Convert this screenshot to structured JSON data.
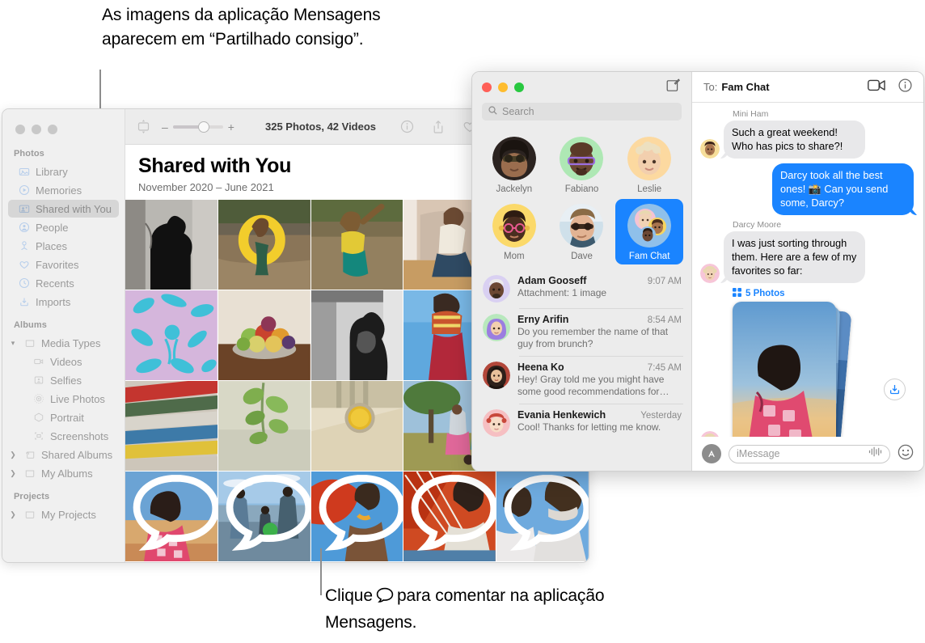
{
  "callouts": {
    "top": "As imagens da aplicação Mensagens aparecem em “Partilhado consigo”.",
    "bottom_before": "Clique",
    "bottom_after": "para comentar na aplicação Mensagens."
  },
  "photos_app": {
    "toolbar": {
      "zoom_out": "–",
      "zoom_in": "+",
      "count_label": "325 Photos, 42 Videos"
    },
    "header": {
      "title": "Shared with You",
      "subtitle": "November 2020 – June 2021"
    },
    "sidebar": {
      "groups": [
        {
          "title": "Photos",
          "items": [
            {
              "label": "Library",
              "icon": "library-icon",
              "selected": false
            },
            {
              "label": "Memories",
              "icon": "memories-icon",
              "selected": false
            },
            {
              "label": "Shared with You",
              "icon": "shared-with-you-icon",
              "selected": true
            },
            {
              "label": "People",
              "icon": "people-icon",
              "selected": false
            },
            {
              "label": "Places",
              "icon": "places-icon",
              "selected": false
            },
            {
              "label": "Favorites",
              "icon": "heart-icon",
              "selected": false
            },
            {
              "label": "Recents",
              "icon": "clock-icon",
              "selected": false
            },
            {
              "label": "Imports",
              "icon": "import-icon",
              "selected": false
            }
          ]
        },
        {
          "title": "Albums",
          "items": [
            {
              "label": "Media Types",
              "icon": "folder-icon",
              "disclosure": "open",
              "nested": false
            },
            {
              "label": "Videos",
              "icon": "video-icon",
              "nested": true
            },
            {
              "label": "Selfies",
              "icon": "selfie-icon",
              "nested": true
            },
            {
              "label": "Live Photos",
              "icon": "live-photo-icon",
              "nested": true
            },
            {
              "label": "Portrait",
              "icon": "portrait-icon",
              "nested": true
            },
            {
              "label": "Screenshots",
              "icon": "screenshot-icon",
              "nested": true
            },
            {
              "label": "Shared Albums",
              "icon": "shared-folder-icon",
              "disclosure": "closed",
              "nested": false
            },
            {
              "label": "My Albums",
              "icon": "folder-icon",
              "disclosure": "closed",
              "nested": false
            }
          ]
        },
        {
          "title": "Projects",
          "items": [
            {
              "label": "My Projects",
              "icon": "folder-icon",
              "disclosure": "closed",
              "nested": false
            }
          ]
        }
      ]
    },
    "grid": {
      "rows": 4,
      "columns": 5,
      "comment_badge_row": 4,
      "photos": [
        {
          "name": "silhouette-bw",
          "has_comment": false
        },
        {
          "name": "child-yellow-float",
          "has_comment": false
        },
        {
          "name": "child-splashing",
          "has_comment": false
        },
        {
          "name": "man-sitting-wall",
          "has_comment": false
        },
        {
          "name": "portrait-window",
          "has_comment": false
        },
        {
          "name": "blue-floral-fabric",
          "has_comment": false
        },
        {
          "name": "fruit-bowl",
          "has_comment": false
        },
        {
          "name": "woman-porch-bw",
          "has_comment": false
        },
        {
          "name": "woman-red-pants",
          "has_comment": false
        },
        {
          "name": "sky-detail",
          "has_comment": false
        },
        {
          "name": "colored-pipes",
          "has_comment": false
        },
        {
          "name": "green-leaves",
          "has_comment": false
        },
        {
          "name": "yellow-bowl",
          "has_comment": false
        },
        {
          "name": "family-under-tree",
          "has_comment": false
        },
        {
          "name": "field-grass",
          "has_comment": false
        },
        {
          "name": "woman-pink-sunset",
          "has_comment": true
        },
        {
          "name": "beach-family",
          "has_comment": true
        },
        {
          "name": "boy-orange-sail",
          "has_comment": true
        },
        {
          "name": "man-orange-sail",
          "has_comment": true
        },
        {
          "name": "father-and-son",
          "has_comment": true
        }
      ]
    }
  },
  "messages_app": {
    "search": {
      "placeholder": "Search"
    },
    "compose_icon": "compose-icon",
    "pinned": [
      {
        "name": "Jackelyn",
        "avatar": "jackelyn-avatar",
        "selected": false
      },
      {
        "name": "Fabiano",
        "avatar": "fabiano-memoji",
        "selected": false
      },
      {
        "name": "Leslie",
        "avatar": "leslie-memoji",
        "selected": false
      },
      {
        "name": "Mom",
        "avatar": "mom-memoji",
        "selected": false
      },
      {
        "name": "Dave",
        "avatar": "dave-avatar",
        "selected": false
      },
      {
        "name": "Fam Chat",
        "avatar": "fam-chat-group",
        "selected": true
      }
    ],
    "conversations": [
      {
        "name": "Adam Gooseff",
        "time": "9:07 AM",
        "preview": "Attachment: 1 image",
        "avatar": "adam-memoji"
      },
      {
        "name": "Erny Arifin",
        "time": "8:54 AM",
        "preview": "Do you remember the name of that guy from brunch?",
        "avatar": "erny-memoji"
      },
      {
        "name": "Heena Ko",
        "time": "7:45 AM",
        "preview": "Hey! Gray told me you might have some good recommendations for our…",
        "avatar": "heena-avatar"
      },
      {
        "name": "Evania Henkewich",
        "time": "Yesterday",
        "preview": "Cool! Thanks for letting me know.",
        "avatar": "evania-memoji"
      }
    ],
    "chat": {
      "to_label": "To:",
      "title": "Fam Chat",
      "facetime_icon": "video-camera-icon",
      "info_icon": "info-icon",
      "messages": [
        {
          "sender": "Mini Ham",
          "text": "Such a great weekend! Who has pics to share?!",
          "direction": "in",
          "avatar": "mini-ham-memoji"
        },
        {
          "sender": "",
          "text": "Darcy took all the best ones! 📸 Can you send some, Darcy?",
          "direction": "out",
          "avatar": ""
        },
        {
          "sender": "Darcy Moore",
          "text": "I was just sorting through them. Here are a few of my favorites so far:",
          "direction": "in",
          "avatar": "darcy-memoji"
        }
      ],
      "attachment": {
        "label": "5 Photos",
        "icon": "grid-icon",
        "download_icon": "download-icon"
      },
      "input": {
        "placeholder": "iMessage",
        "dictation_icon": "waveform-icon",
        "emoji_icon": "emoji-icon",
        "apps_icon": "app-store-icon"
      }
    }
  }
}
